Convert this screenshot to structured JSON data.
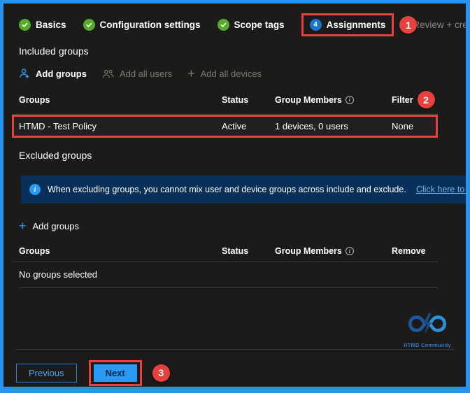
{
  "colors": {
    "frame_border": "#2a93ee",
    "background": "#1c1b1a",
    "annotation_red": "#e8413d",
    "step_done_green": "#57ab2b",
    "step_current_blue": "#1775d2",
    "accent_blue": "#2899f5",
    "banner_bg": "#082f58",
    "link_blue": "#6cb8f6",
    "disabled_gray": "#7a7874"
  },
  "steps": {
    "items": [
      {
        "label": "Basics",
        "state": "done"
      },
      {
        "label": "Configuration settings",
        "state": "done"
      },
      {
        "label": "Scope tags",
        "state": "done"
      },
      {
        "label": "Assignments",
        "state": "current",
        "number": "4"
      },
      {
        "label": "Review + create",
        "state": "upcoming"
      }
    ]
  },
  "annotations": {
    "step_badge": "1",
    "filter_badge": "2",
    "next_badge": "3"
  },
  "included": {
    "title": "Included groups",
    "toolbar": {
      "add_groups": "Add groups",
      "add_all_users": "Add all users",
      "add_all_devices": "Add all devices"
    },
    "table": {
      "headers": {
        "groups": "Groups",
        "status": "Status",
        "members": "Group Members",
        "filter": "Filter"
      },
      "row": {
        "group": "HTMD - Test Policy",
        "status": "Active",
        "members": "1 devices, 0 users",
        "filter": "None"
      }
    }
  },
  "excluded": {
    "title": "Excluded groups",
    "banner": {
      "message": "When excluding groups, you cannot mix user and device groups across include and exclude.",
      "link": "Click here to learn more about"
    },
    "add_groups": "Add groups",
    "table": {
      "headers": {
        "groups": "Groups",
        "status": "Status",
        "members": "Group Members",
        "remove": "Remove"
      },
      "empty": "No groups selected"
    }
  },
  "watermark": {
    "label": "HTMD Community"
  },
  "footer": {
    "previous": "Previous",
    "next": "Next"
  }
}
